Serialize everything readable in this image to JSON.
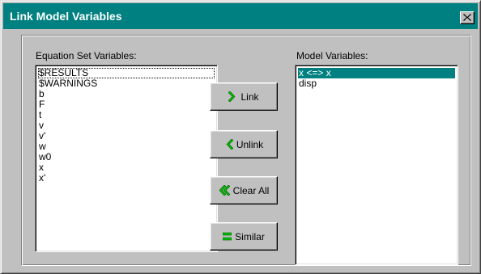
{
  "window": {
    "title": "Link Model Variables",
    "close_glyph": "✕"
  },
  "equation_set": {
    "label": "Equation Set Variables:",
    "items": [
      "$RESULTS",
      "$WARNINGS",
      "b",
      "F",
      "t",
      "v",
      "v'",
      "w",
      "w0",
      "x",
      "x'"
    ],
    "focused_index": 0
  },
  "model": {
    "label": "Model Variables:",
    "items": [
      "x <=> x",
      "disp"
    ],
    "selected_index": 0
  },
  "buttons": {
    "link": {
      "label": "Link",
      "icon": "chevron-right-icon"
    },
    "unlink": {
      "label": "Unlink",
      "icon": "chevron-left-icon"
    },
    "clear_all": {
      "label": "Clear All",
      "icon": "double-chevron-left-icon"
    },
    "similar": {
      "label": "Similar",
      "icon": "equals-icon"
    }
  },
  "colors": {
    "title_bar": "#008080",
    "selection": "#008080",
    "icon_green": "#00c000",
    "face": "#c0c0c0"
  }
}
